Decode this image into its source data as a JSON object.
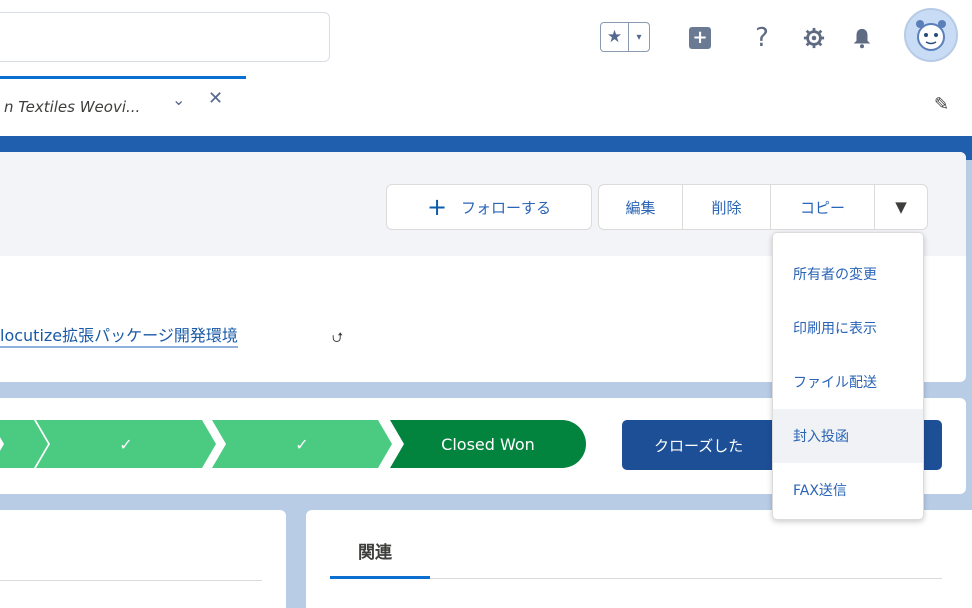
{
  "header": {
    "search_value": "",
    "icons": [
      "favorites-star-icon",
      "favorites-dropdown-icon",
      "global-actions-icon",
      "help-icon",
      "setup-gear-icon",
      "notifications-bell-icon",
      "avatar"
    ]
  },
  "tabs": {
    "active_label": "n Textiles Weovi...",
    "chevron": "⌄",
    "close": "✕"
  },
  "record": {
    "follow_label": "フォローする",
    "actions": [
      "編集",
      "削除",
      "コピー"
    ],
    "owner_link": "locutize拡張パッケージ開発環境"
  },
  "path": {
    "stages": [
      "",
      "✓",
      "✓"
    ],
    "closed_label": "Closed Won",
    "mark_button_label": "クローズした"
  },
  "related": {
    "title": "関連"
  },
  "menu": {
    "items": [
      "所有者の変更",
      "印刷用に表示",
      "ファイル配送",
      "封入投函",
      "FAX送信"
    ],
    "hovered_index": 3
  },
  "colors": {
    "brand_blue": "#1f5fae",
    "path_complete": "#4bca81",
    "path_won": "#03843e",
    "mark_button": "#1d4f97",
    "link": "#2a64b6"
  }
}
